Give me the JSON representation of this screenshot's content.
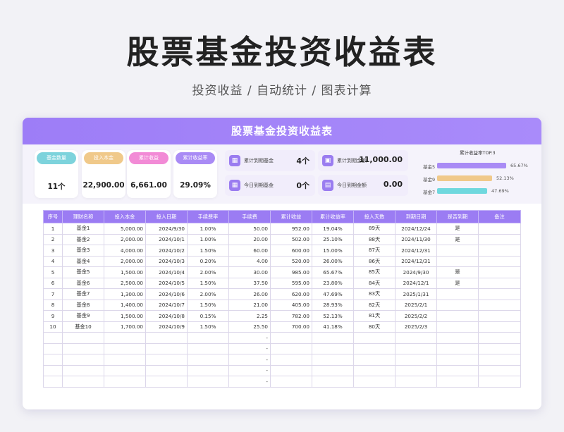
{
  "page": {
    "title": "股票基金投资收益表",
    "subtitle": "投资收益 / 自动统计 / 图表计算"
  },
  "sheet": {
    "header": "股票基金投资收益表"
  },
  "kpis": [
    {
      "label": "基金数量",
      "value": "11个",
      "color": "#7dd3dc"
    },
    {
      "label": "投入本金",
      "value": "22,900.00",
      "color": "#f0c98a"
    },
    {
      "label": "累计收益",
      "value": "6,661.00",
      "color": "#f28bd6"
    },
    {
      "label": "累计收益率",
      "value": "29.09%",
      "color": "#a98bf5"
    }
  ],
  "mini_cards": [
    {
      "label": "累计到期基金",
      "value": "4个",
      "icon": "grid-icon"
    },
    {
      "label": "累计到期金额",
      "value": "11,000.00",
      "icon": "wallet-icon"
    },
    {
      "label": "今日到期基金",
      "value": "0个",
      "icon": "grid-icon"
    },
    {
      "label": "今日到期金额",
      "value": "0.00",
      "icon": "document-icon"
    }
  ],
  "top3": {
    "title": "累计收益率TOP.3",
    "items": [
      {
        "name": "基金5",
        "value": 65.67,
        "label": "65.67%",
        "color": "#a98bf5"
      },
      {
        "name": "基金9",
        "value": 52.13,
        "label": "52.13%",
        "color": "#f0c98a"
      },
      {
        "name": "基金7",
        "value": 47.69,
        "label": "47.69%",
        "color": "#6fd8de"
      }
    ]
  },
  "table": {
    "headers": [
      "序号",
      "理财名称",
      "投入本金",
      "投入日期",
      "手续费率",
      "手续费",
      "累计收益",
      "累计收益率",
      "投入天数",
      "到期日期",
      "是否到期",
      "备注"
    ],
    "rows": [
      [
        "1",
        "基金1",
        "5,000.00",
        "2024/9/30",
        "1.00%",
        "50.00",
        "952.00",
        "19.04%",
        "89天",
        "2024/12/24",
        "是",
        ""
      ],
      [
        "2",
        "基金2",
        "2,000.00",
        "2024/10/1",
        "1.00%",
        "20.00",
        "502.00",
        "25.10%",
        "88天",
        "2024/11/30",
        "是",
        ""
      ],
      [
        "3",
        "基金3",
        "4,000.00",
        "2024/10/2",
        "1.50%",
        "60.00",
        "600.00",
        "15.00%",
        "87天",
        "2024/12/31",
        "",
        ""
      ],
      [
        "4",
        "基金4",
        "2,000.00",
        "2024/10/3",
        "0.20%",
        "4.00",
        "520.00",
        "26.00%",
        "86天",
        "2024/12/31",
        "",
        ""
      ],
      [
        "5",
        "基金5",
        "1,500.00",
        "2024/10/4",
        "2.00%",
        "30.00",
        "985.00",
        "65.67%",
        "85天",
        "2024/9/30",
        "是",
        ""
      ],
      [
        "6",
        "基金6",
        "2,500.00",
        "2024/10/5",
        "1.50%",
        "37.50",
        "595.00",
        "23.80%",
        "84天",
        "2024/12/1",
        "是",
        ""
      ],
      [
        "7",
        "基金7",
        "1,300.00",
        "2024/10/6",
        "2.00%",
        "26.00",
        "620.00",
        "47.69%",
        "83天",
        "2025/1/31",
        "",
        ""
      ],
      [
        "8",
        "基金8",
        "1,400.00",
        "2024/10/7",
        "1.50%",
        "21.00",
        "405.00",
        "28.93%",
        "82天",
        "2025/2/1",
        "",
        ""
      ],
      [
        "9",
        "基金9",
        "1,500.00",
        "2024/10/8",
        "0.15%",
        "2.25",
        "782.00",
        "52.13%",
        "81天",
        "2025/2/2",
        "",
        ""
      ],
      [
        "10",
        "基金10",
        "1,700.00",
        "2024/10/9",
        "1.50%",
        "25.50",
        "700.00",
        "41.18%",
        "80天",
        "2025/2/3",
        "",
        ""
      ],
      [
        "",
        "",
        "",
        "",
        "",
        "-",
        "",
        "",
        "",
        "",
        "",
        ""
      ],
      [
        "",
        "",
        "",
        "",
        "",
        "-",
        "",
        "",
        "",
        "",
        "",
        ""
      ],
      [
        "",
        "",
        "",
        "",
        "",
        "-",
        "",
        "",
        "",
        "",
        "",
        ""
      ],
      [
        "",
        "",
        "",
        "",
        "",
        "-",
        "",
        "",
        "",
        "",
        "",
        ""
      ],
      [
        "",
        "",
        "",
        "",
        "",
        "-",
        "",
        "",
        "",
        "",
        "",
        ""
      ]
    ]
  }
}
